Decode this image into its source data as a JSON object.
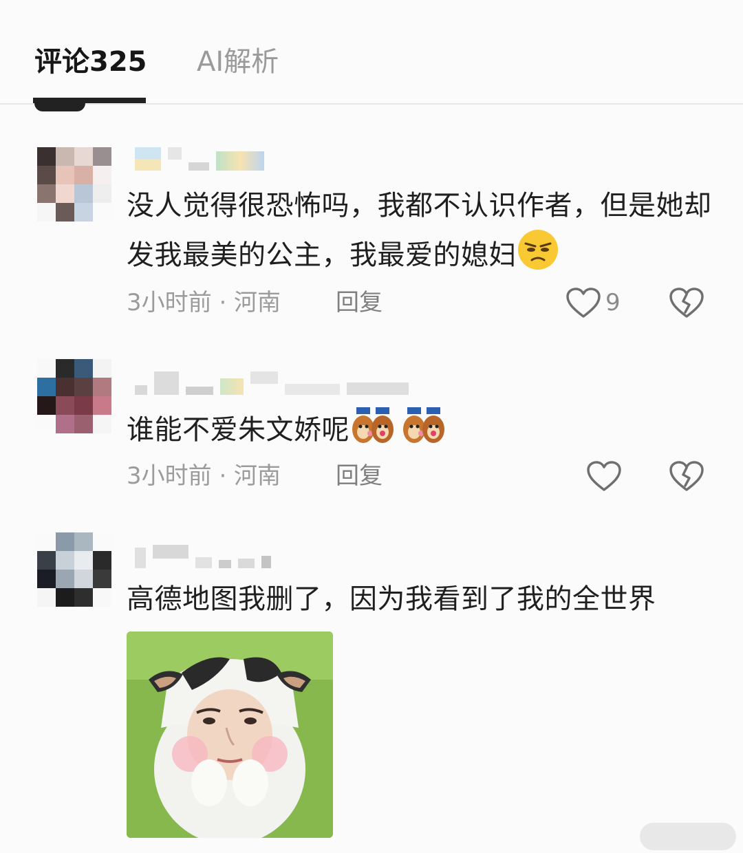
{
  "tabs": {
    "comments": "评论325",
    "ai": "AI解析"
  },
  "comments": [
    {
      "text": "没人觉得很恐怖吗，我都不认识作者，但是她却发我最美的公主，我最爱的媳妇",
      "emoji": "annoyed-face-emoji",
      "time_location": "3小时前 · 河南",
      "reply": "回复",
      "likes": "9"
    },
    {
      "text": "谁能不爱朱文娇呢",
      "emoji": "chipmunk-sticker-emoji",
      "time_location": "3小时前 · 河南",
      "reply": "回复",
      "likes": ""
    },
    {
      "text": "高德地图我删了，因为我看到了我的全世界",
      "image": "cow-costume-face-sticker",
      "time_location": "",
      "reply": "",
      "likes": ""
    }
  ],
  "icons": {
    "like": "heart-outline-icon",
    "dislike": "broken-heart-icon"
  }
}
